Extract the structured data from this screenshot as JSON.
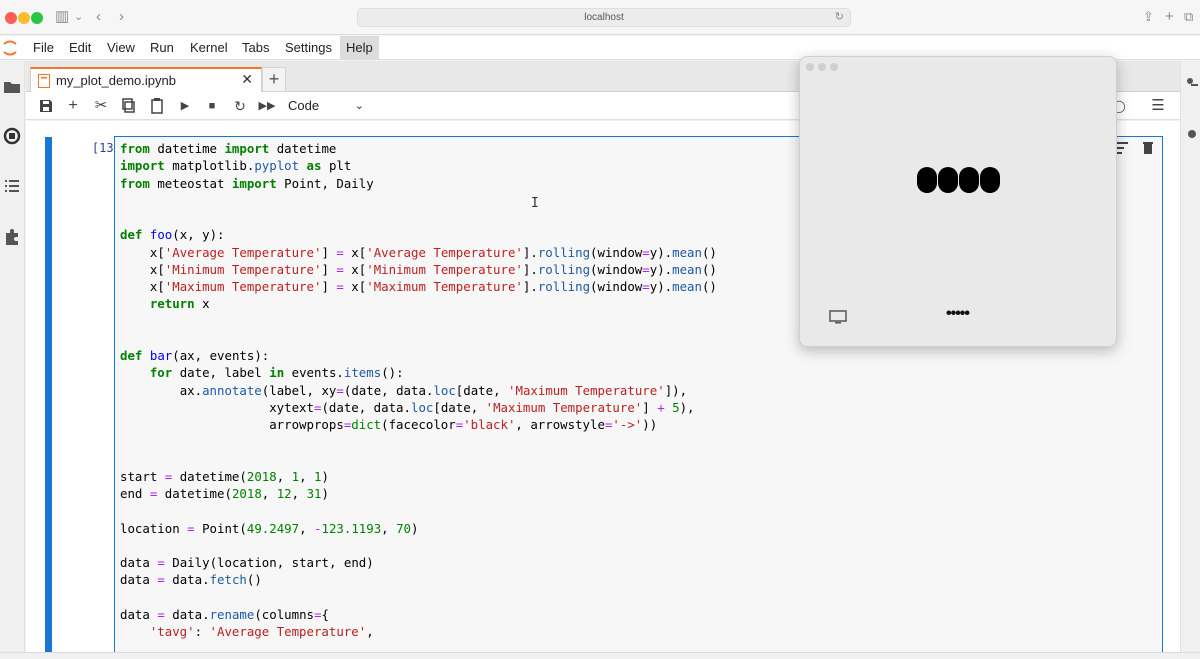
{
  "browser": {
    "address": "localhost",
    "icons": [
      "sidebar-toggle-icon",
      "back-icon",
      "forward-icon",
      "reload-icon",
      "share-icon",
      "new-tab-icon",
      "tabs-overview-icon"
    ]
  },
  "menubar": {
    "items": [
      "File",
      "Edit",
      "View",
      "Run",
      "Kernel",
      "Tabs",
      "Settings",
      "Help"
    ],
    "active": "Help"
  },
  "tab": {
    "title": "my_plot_demo.ipynb",
    "close": "✕",
    "new": "+"
  },
  "toolbar": {
    "cell_type": "Code",
    "buttons": [
      "save-icon",
      "add-cell-icon",
      "cut-icon",
      "copy-icon",
      "paste-icon",
      "run-icon",
      "stop-icon",
      "restart-icon",
      "fast-forward-icon"
    ]
  },
  "cell": {
    "prompt": "[13]:",
    "code": [
      "from datetime import datetime",
      "import matplotlib.pyplot as plt",
      "from meteostat import Point, Daily",
      "",
      "",
      "def foo(x, y):",
      "    x['Average Temperature'] = x['Average Temperature'].rolling(window=y).mean()",
      "    x['Minimum Temperature'] = x['Minimum Temperature'].rolling(window=y).mean()",
      "    x['Maximum Temperature'] = x['Maximum Temperature'].rolling(window=y).mean()",
      "    return x",
      "",
      "",
      "def bar(ax, events):",
      "    for date, label in events.items():",
      "        ax.annotate(label, xy=(date, data.loc[date, 'Maximum Temperature']),",
      "                    xytext=(date, data.loc[date, 'Maximum Temperature'] + 5),",
      "                    arrowprops=dict(facecolor='black', arrowstyle='->'))",
      "",
      "",
      "start = datetime(2018, 1, 1)",
      "end = datetime(2018, 12, 31)",
      "",
      "location = Point(49.2497, -123.1193, 70)",
      "",
      "data = Daily(location, start, end)",
      "data = data.fetch()",
      "",
      "data = data.rename(columns={",
      "    'tavg': 'Average Temperature',"
    ]
  },
  "overlay": {
    "dots_text": "•••••"
  },
  "colors": {
    "accent": "#1976d2",
    "tab_accent": "#f37726"
  }
}
